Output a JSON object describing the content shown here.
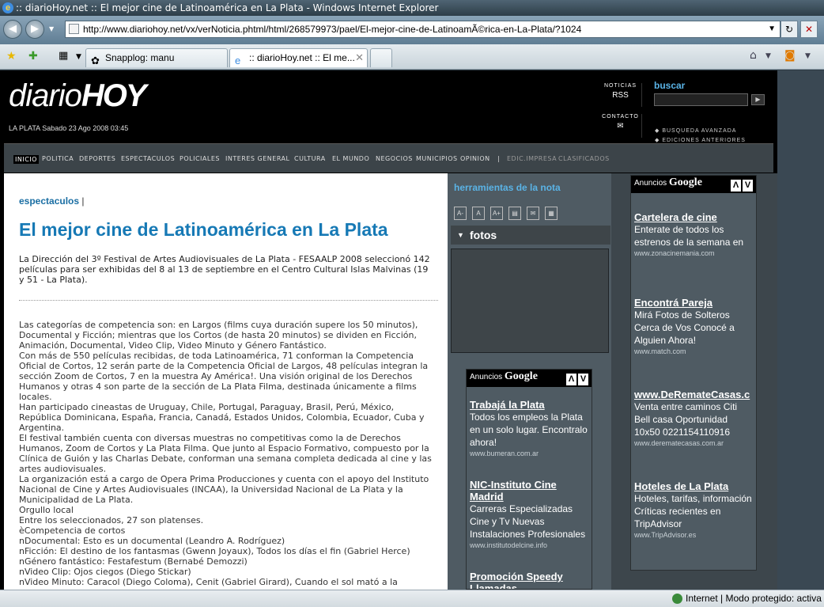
{
  "browser": {
    "title": ":: diarioHoy.net :: El mejor cine de Latinoamérica en La Plata - Windows Internet Explorer",
    "url": "http://www.diariohoy.net/vx/verNoticia.phtml/html/268579973/pael/El-mejor-cine-de-LatinoamÃ©rica-en-La-Plata/?1024",
    "tabs": [
      {
        "label": "Snapplog: manu"
      },
      {
        "label": ":: diarioHoy.net :: El me..."
      }
    ],
    "status": "Internet | Modo protegido: activa"
  },
  "site": {
    "logo_part1": "diario",
    "logo_part2": "HOY",
    "date": "LA PLATA Sabado 23 Ago 2008 03:45",
    "noticias_label": "NOTICIAS",
    "noticias_value": "RSS",
    "contacto_label": "CONTACTO",
    "contacto_icon": "✉",
    "buscar": "buscar",
    "busqueda_avanzada": "◆ BUSQUEDA AVANZADA",
    "ediciones_anteriores": "◆ EDICIONES ANTERIORES",
    "menu": [
      "INICIO",
      "POLITICA",
      "DEPORTES",
      "ESPECTACULOS",
      "POLICIALES",
      "INTERES GENERAL",
      "CULTURA",
      "EL MUNDO",
      "NEGOCIOS",
      "MUNICIPIOS",
      "OPINION",
      "|",
      "EDIC.IMPRESA",
      "CLASIFICADOS"
    ]
  },
  "article": {
    "section": "espectaculos",
    "section_sep": " |",
    "headline": "El mejor cine de Latinoamérica en La Plata",
    "lead": "La Dirección del 3º Festival de Artes Audiovisuales de La Plata - FESAALP 2008 seleccionó 142 películas para ser exhibidas del 8 al 13 de septiembre en el Centro Cultural Islas Malvinas (19 y 51 - La Plata).",
    "paragraphs": [
      "Las categorías de competencia son: en Largos (films cuya duración supere los 50 minutos), Documental y Ficción; mientras que los Cortos (de hasta 20 minutos) se dividen en Ficción, Animación, Documental, Video Clip, Video Minuto y Género Fantástico.",
      "Con más de 550 películas recibidas, de toda Latinoamérica, 71 conforman la Competencia Oficial de Cortos, 12 serán parte de la Competencia Oficial de Largos, 48 películas integran la sección Zoom de Cortos, 7 en la muestra Ay América!. Una visión original de los Derechos Humanos y otras 4 son parte de la sección de La Plata Filma, destinada únicamente a films locales.",
      "Han participado cineastas de Uruguay, Chile, Portugal, Paraguay, Brasil, Perú, México, República Dominicana, España, Francia, Canadá, Estados Unidos, Colombia, Ecuador, Cuba y Argentina.",
      "El festival también cuenta con diversas muestras no competitivas como la de Derechos Humanos, Zoom de Cortos y La Plata Filma. Que junto al Espacio Formativo, compuesto por la Clínica de Guión y las Charlas Debate, conforman una semana completa dedicada al cine y las artes audiovisuales.",
      "La organización está a cargo de Opera Prima Producciones y cuenta con el apoyo del Instituto Nacional de Cine y Artes Audiovisuales (INCAA), la Universidad Nacional de La Plata y la Municipalidad de La Plata.",
      "Orgullo local",
      "Entre los seleccionados, 27 son platenses.",
      "èCompetencia de cortos",
      "nDocumental: Esto es un documental (Leandro A. Rodríguez)",
      "nFicción: El destino de los fantasmas (Gwenn Joyaux), Todos los días el fin (Gabriel Herce)",
      "nGénero fantástico: Festafestum (Bernabé Demozzi)",
      "nVideo Clip: Ojos ciegos (Diego Stickar)",
      "nVideo Minuto: Caracol (Diego Coloma), Cenit (Gabriel Girard), Cuando el sol mató a la"
    ]
  },
  "tools": {
    "title": "herramientas de la nota",
    "icons": [
      "A-",
      "A",
      "A+",
      "▤",
      "✉",
      "▦"
    ],
    "fotos": "fotos"
  },
  "ads_small": {
    "header": "Anuncios",
    "brand": "Google",
    "items": [
      {
        "title": "Trabajá la Plata",
        "text": "Todos los empleos la Plata en un solo lugar. Encontralo ahora!",
        "url": "www.bumeran.com.ar"
      },
      {
        "title": "NIC-Instituto Cine Madrid",
        "text": "Carreras Especializadas Cine y Tv Nuevas Instalaciones Profesionales",
        "url": "www.institutodelcine.info"
      },
      {
        "title": "Promoción Speedy Llamadas",
        "text": "",
        "url": ""
      }
    ]
  },
  "ads_large": {
    "header": "Anuncios",
    "brand": "Google",
    "items": [
      {
        "title": "Cartelera de cine",
        "text": "Enterate de todos los estrenos de la semana en",
        "url": "www.zonacinemania.com"
      },
      {
        "title": "Encontrá Pareja",
        "text": "Mirá Fotos de Solteros Cerca de Vos Conocé a Alguien Ahora!",
        "url": "www.match.com"
      },
      {
        "title": "www.DeRemateCasas.c",
        "text": "Venta entre caminos Citi Bell casa Oportunidad 10x50 0221154110916",
        "url": "www.derematecasas.com.ar"
      },
      {
        "title": "Hoteles de La Plata",
        "text": "Hoteles, tarifas, información Críticas recientes en TripAdvisor",
        "url": "www.TripAdvisor.es"
      }
    ]
  }
}
